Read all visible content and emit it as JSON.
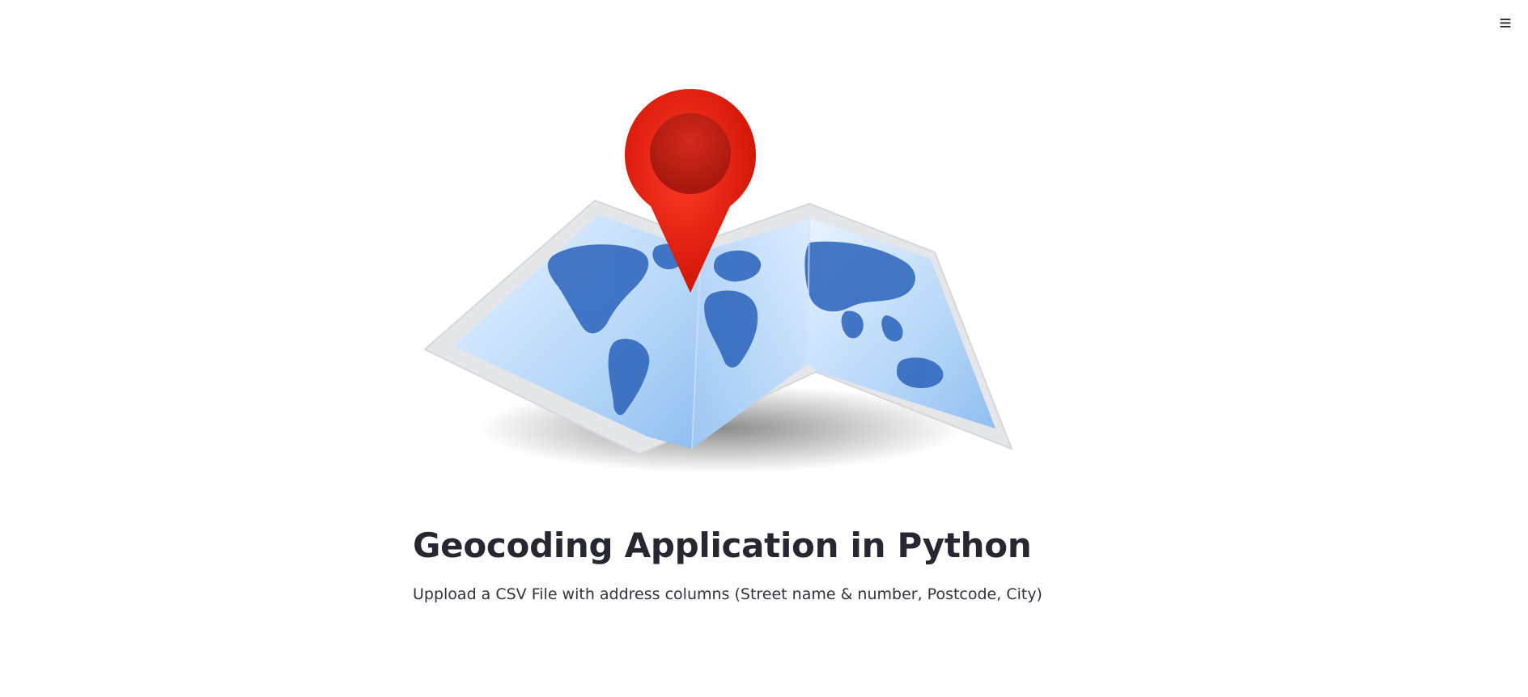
{
  "header": {
    "menu_icon": "hamburger-menu-icon"
  },
  "main": {
    "hero_image": {
      "icon": "map-pin-icon",
      "pin_color": "#e01a0a",
      "map_color": "#a9cdf5",
      "land_color": "#2c62b8"
    },
    "title": "Geocoding Application in Python",
    "subtitle": "Uppload a CSV File with address columns (Street name & number, Postcode, City)"
  }
}
